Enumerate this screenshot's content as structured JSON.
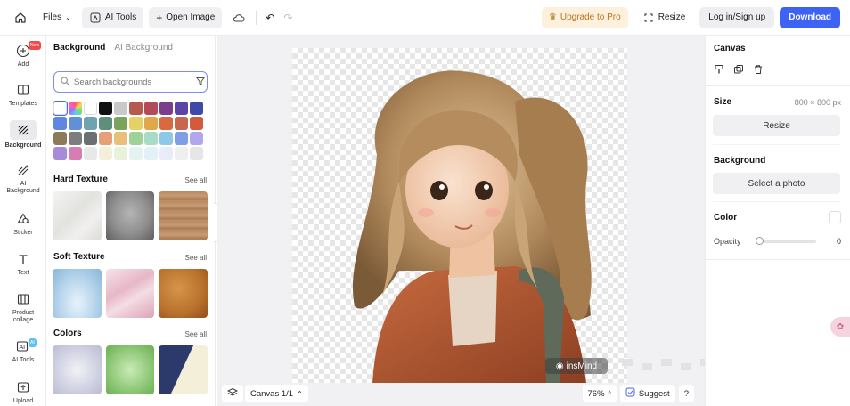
{
  "topbar": {
    "files_label": "Files",
    "ai_tools_label": "AI Tools",
    "open_image_label": "Open Image",
    "upgrade_label": "Upgrade to Pro",
    "resize_label": "Resize",
    "login_label": "Log in/Sign up",
    "download_label": "Download"
  },
  "rail": {
    "items": [
      {
        "label": "Add",
        "badge": "New"
      },
      {
        "label": "Templates"
      },
      {
        "label": "Background"
      },
      {
        "label": "AI Background"
      },
      {
        "label": "Sticker"
      },
      {
        "label": "Text"
      },
      {
        "label": "Product collage"
      },
      {
        "label": "AI Tools",
        "badge": "AI"
      },
      {
        "label": "Upload"
      }
    ]
  },
  "panel": {
    "tab_active": "Background",
    "tab_other": "AI Background",
    "search_placeholder": "Search backgrounds",
    "swatch_colors": [
      "#ffffff",
      "rainbow",
      "#ffffff",
      "#111111",
      "#c9c9c9",
      "#b65a4f",
      "#b24a58",
      "#7a3f8c",
      "#5b43a8",
      "#3f4aa8",
      "#5f86e0",
      "#5f90d8",
      "#6fa3b0",
      "#5e8e7c",
      "#7ba35c",
      "#e6d264",
      "#e0a848",
      "#d86a42",
      "#c7674e",
      "#d35a3a",
      "#8d7a58",
      "#7d7d7d",
      "#6b6e73",
      "#e89f76",
      "#e9c07b",
      "#9fd29a",
      "#a8dcc7",
      "#8fc7e6",
      "#7e9ee6",
      "#b2a7ec",
      "#a98ad8",
      "#d77db4",
      "#e8e8e8",
      "#f3efda",
      "#e7f2da",
      "#e3f3f0",
      "#e4f0f8",
      "#e9ecf8",
      "#efeff1",
      "#e6e6e8"
    ],
    "sections": [
      {
        "title": "Hard Texture",
        "see_all": "See all"
      },
      {
        "title": "Soft Texture",
        "see_all": "See all"
      },
      {
        "title": "Colors",
        "see_all": "See all"
      }
    ]
  },
  "canvas": {
    "watermark": "insMind",
    "page_label": "Canvas 1/1",
    "zoom": "76%",
    "suggest_label": "Suggest",
    "help_label": "?"
  },
  "right": {
    "canvas_title": "Canvas",
    "size_label": "Size",
    "size_value": "800 × 800 px",
    "resize_button": "Resize",
    "background_title": "Background",
    "select_photo_button": "Select a photo",
    "color_label": "Color",
    "opacity_label": "Opacity",
    "opacity_value": "0"
  },
  "colors": {
    "accent": "#3d63f5",
    "upgrade_bg": "#fdf0dc",
    "upgrade_text": "#b8741a"
  }
}
